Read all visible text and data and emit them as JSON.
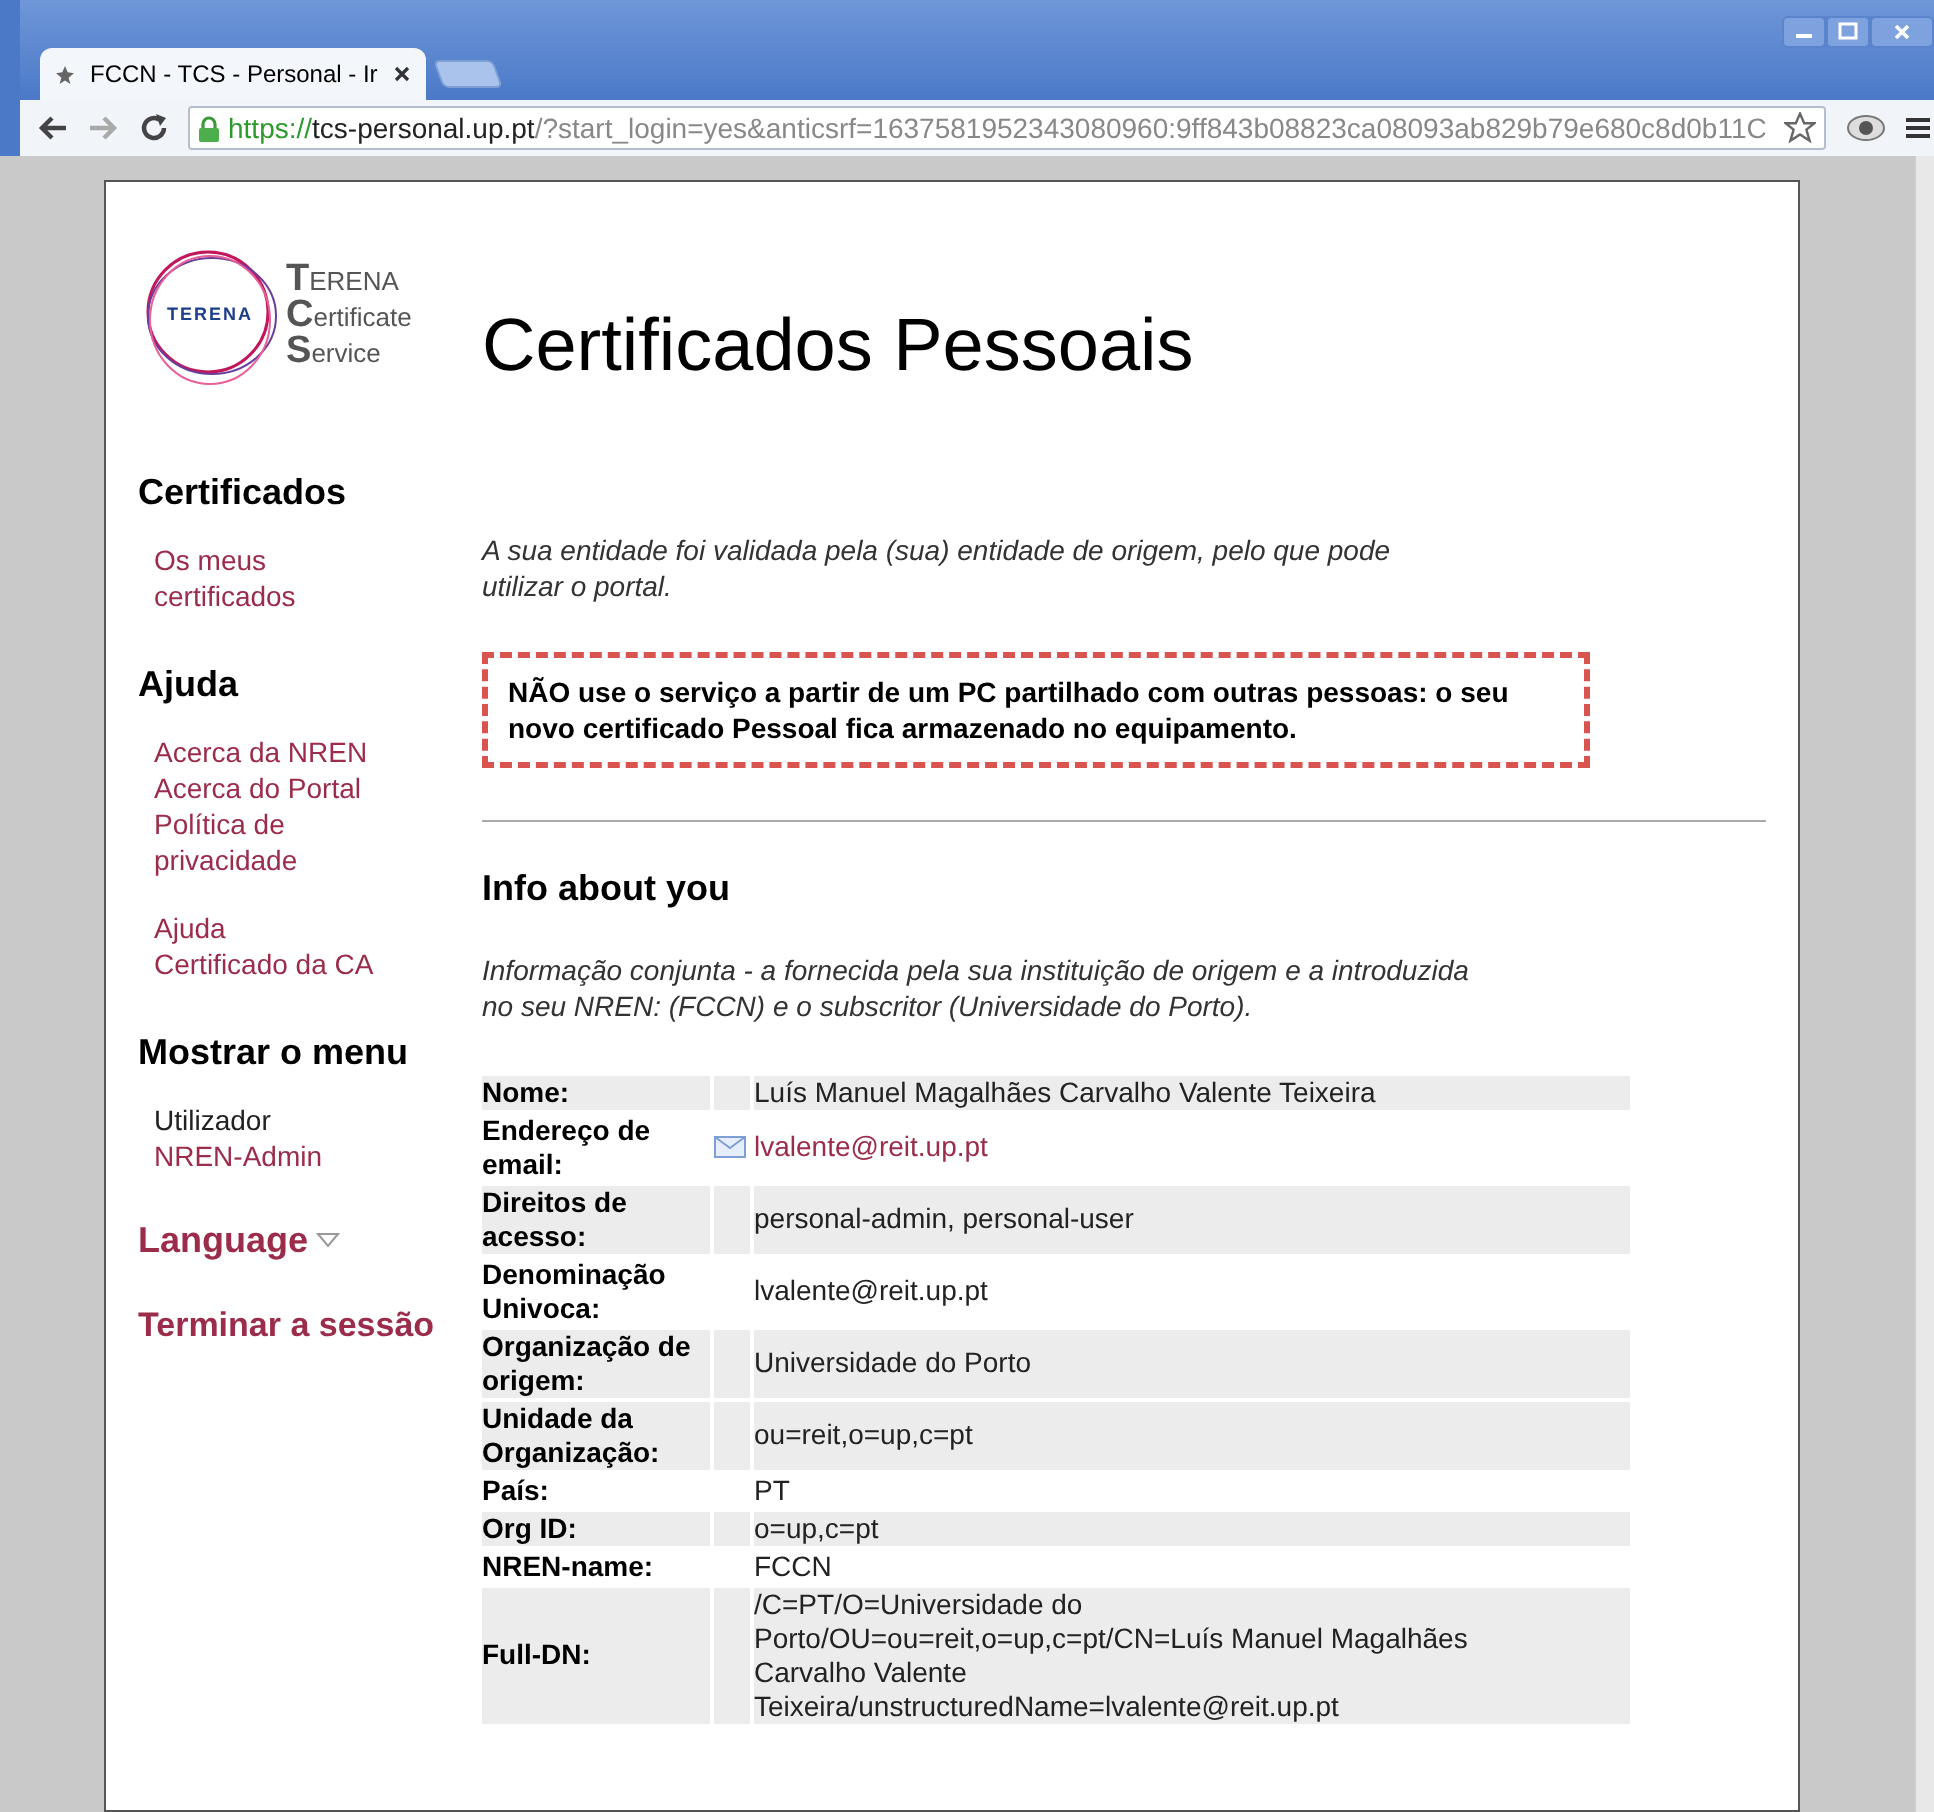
{
  "browser": {
    "tab_title": "FCCN - TCS - Personal - Ir",
    "url": {
      "scheme": "https://",
      "host": "tcs-personal.up.pt",
      "rest": "/?start_login=yes&anticsrf=1637581952343080960:9ff843b08823ca08093ab829b79e680c8d0b11C"
    }
  },
  "logo": {
    "mark": "TERENA",
    "lines": [
      {
        "initial": "T",
        "rest": "ERENA"
      },
      {
        "initial": "C",
        "rest": "ertificate"
      },
      {
        "initial": "S",
        "rest": "ervice"
      }
    ]
  },
  "page_title": "Certificados Pessoais",
  "sidebar": {
    "sections": [
      {
        "heading": "Certificados",
        "groups": [
          [
            {
              "label": "Os meus certificados",
              "link": true
            }
          ]
        ]
      },
      {
        "heading": "Ajuda",
        "groups": [
          [
            {
              "label": "Acerca da NREN",
              "link": true
            },
            {
              "label": "Acerca do Portal",
              "link": true
            },
            {
              "label": "Política de privacidade",
              "link": true
            }
          ],
          [
            {
              "label": "Ajuda",
              "link": true
            },
            {
              "label": "Certificado da CA",
              "link": true
            }
          ]
        ]
      },
      {
        "heading": "Mostrar o menu",
        "groups": [
          [
            {
              "label": "Utilizador",
              "link": false
            },
            {
              "label": "NREN-Admin",
              "link": true
            }
          ]
        ]
      }
    ],
    "language": "Language",
    "logout": "Terminar a sessão"
  },
  "intro": "A sua entidade foi validada pela (sua) entidade de origem, pelo que pode utilizar o portal.",
  "warning": "NÃO use o serviço a partir de um PC partilhado com outras pessoas: o seu novo certificado Pessoal fica armazenado no equipamento.",
  "info": {
    "heading": "Info about you",
    "description": "Informação conjunta - a fornecida pela sua instituição de origem e a introduzida no seu NREN: (FCCN) e o subscritor (Universidade do Porto).",
    "rows": [
      {
        "label": "Nome:",
        "value": "Luís Manuel Magalhães Carvalho Valente Teixeira",
        "kind": "text",
        "shaded": true
      },
      {
        "label": "Endereço de email:",
        "value": "lvalente@reit.up.pt",
        "kind": "email",
        "shaded": false
      },
      {
        "label": "Direitos de acesso:",
        "value": "personal-admin, personal-user",
        "kind": "text",
        "shaded": true
      },
      {
        "label": "Denominação Univoca:",
        "value": "lvalente@reit.up.pt",
        "kind": "text",
        "shaded": false
      },
      {
        "label": "Organização de origem:",
        "value": "Universidade do Porto",
        "kind": "text",
        "shaded": true
      },
      {
        "label": "Unidade da Organização:",
        "value": "ou=reit,o=up,c=pt",
        "kind": "text",
        "shaded": true
      },
      {
        "label": "País:",
        "value": "PT",
        "kind": "text",
        "shaded": false
      },
      {
        "label": "Org ID:",
        "value": "o=up,c=pt",
        "kind": "text",
        "shaded": true
      },
      {
        "label": "NREN-name:",
        "value": "FCCN",
        "kind": "text",
        "shaded": false
      },
      {
        "label": "Full-DN:",
        "value": "/C=PT/O=Universidade do Porto/OU=ou=reit,o=up,c=pt/CN=Luís Manuel Magalhães Carvalho Valente Teixeira/unstructuredName=lvalente@reit.up.pt",
        "kind": "text",
        "shaded": true
      }
    ]
  }
}
